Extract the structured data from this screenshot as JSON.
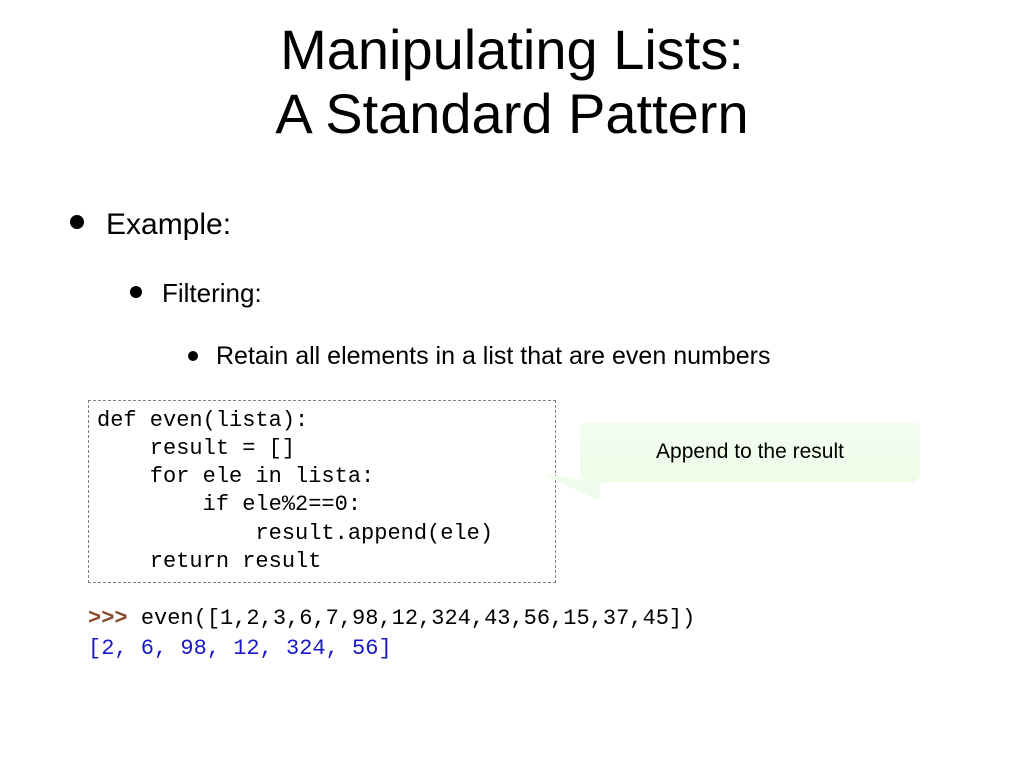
{
  "title_line1": "Manipulating Lists:",
  "title_line2": "A Standard Pattern",
  "bullets": {
    "l1": "Example:",
    "l2": "Filtering:",
    "l3": "Retain all elements in a list that are even numbers"
  },
  "code": "def even(lista):\n    result = []\n    for ele in lista:\n        if ele%2==0:\n            result.append(ele)\n    return result",
  "callout": "Append to the result",
  "repl": {
    "prompt": ">>> ",
    "call": "even([1,2,3,6,7,98,12,324,43,56,15,37,45])",
    "output": "[2, 6, 98, 12, 324, 56]"
  }
}
